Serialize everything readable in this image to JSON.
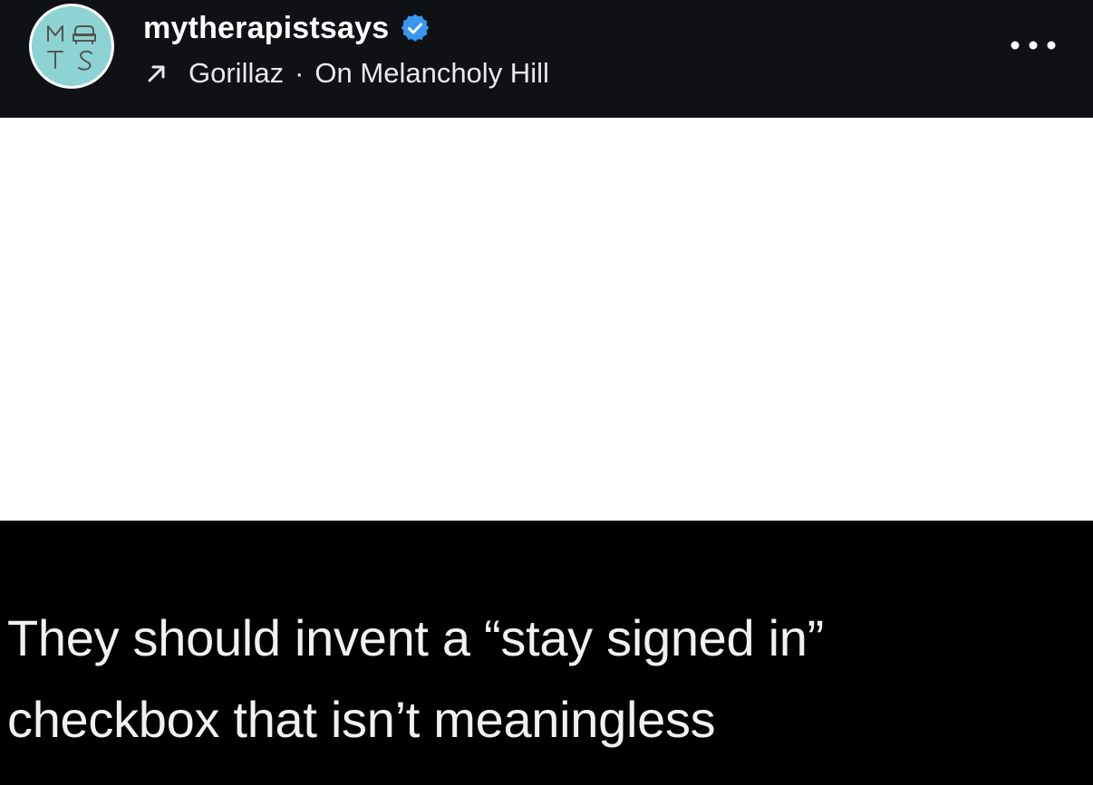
{
  "post": {
    "account": {
      "username": "mytherapistsays",
      "avatar_letters": [
        "M",
        "T",
        "S"
      ],
      "verified": true
    },
    "audio": {
      "artist": "Gorillaz",
      "separator": "·",
      "track": "On Melancholy Hill"
    },
    "caption_lines": [
      "They should invent a “stay signed in”",
      "checkbox that isn’t meaningless"
    ]
  },
  "icons": {
    "verified": "verified-badge-icon",
    "audio": "arrow-up-right-icon",
    "more": "more-horizontal-icon"
  },
  "colors": {
    "header_bg": "#0f1115",
    "avatar_bg": "#8ed3d3",
    "verified_blue": "#3897f0",
    "caption_bg": "#000000",
    "image_bg": "#ffffff"
  }
}
